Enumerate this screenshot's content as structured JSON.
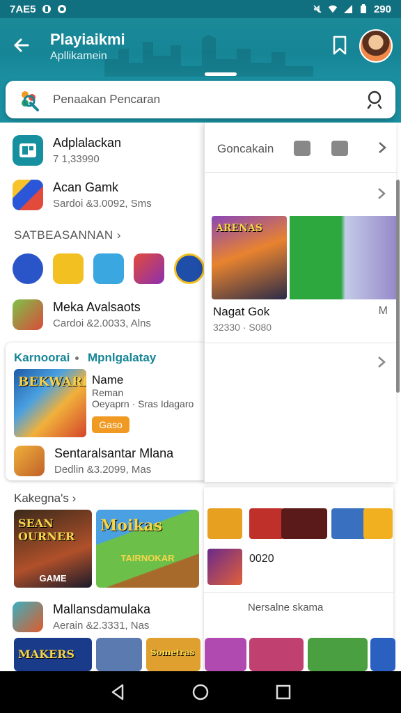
{
  "status_bar": {
    "time": "7AE5",
    "battery": "290"
  },
  "header": {
    "title": "Playiaikmi",
    "subtitle": "Apllikamein"
  },
  "search": {
    "placeholder": "Penaakan Pencaran"
  },
  "list": [
    {
      "name": "Adplalackan",
      "meta": "7 1,33990"
    },
    {
      "name": "Acan Gamk",
      "meta": "Sardoi &3.0092, Sms"
    }
  ],
  "section_recommend": {
    "label": "SATBEASANNAN ›"
  },
  "list2": {
    "name": "Meka Avalsaots",
    "meta": "Cardoi &2.0033, Alns"
  },
  "feature": {
    "tab_a": "Karnoorai",
    "tab_b": "Mpnlgalatay",
    "image_title": "BEKWARI",
    "name": "Name",
    "sub1": "Reman",
    "sub2": "Oeyaprn · Sras Idagaro",
    "button": "Gaso",
    "row2_name": "Sentaralsantar Mlana",
    "row2_meta": "Dedlin &3.2099, Mas"
  },
  "right_panel": {
    "label": "Goncakain",
    "game_image_title": "ARENAS",
    "game_name": "Nagat Gok",
    "game_meta": "32330 · S080",
    "side_letter": "M"
  },
  "lower": {
    "label": "Kakegna's ›",
    "tile1_title": "SEAN OURNER",
    "tile1_caption": "GAME",
    "tile2_title": "Moikas",
    "tile2_sub": "TAIRNOKAR",
    "value": "0020",
    "row_name": "Mallansdamulaka",
    "row_meta": "Aerain &2.3331, Nas",
    "caption": "Nersalne skama",
    "strip1": "MAKERS",
    "strip3": "Sometras"
  },
  "colors": {
    "teal": "#168596",
    "orange": "#f09a23"
  }
}
